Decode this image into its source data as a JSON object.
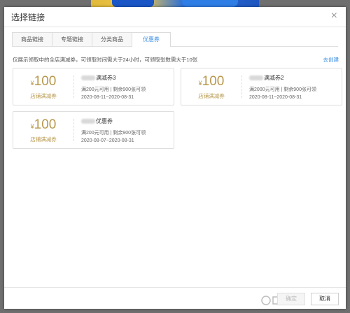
{
  "dialog": {
    "title": "选择链接"
  },
  "tabs": [
    {
      "label": "商品链接",
      "active": false
    },
    {
      "label": "专题链接",
      "active": false
    },
    {
      "label": "分类商品",
      "active": false
    },
    {
      "label": "优惠券",
      "active": true
    }
  ],
  "info": {
    "text": "仅展示领取中的全店满减券，可领取时间需大于24小时，可领取张数需大于10张",
    "create_link": "去创建"
  },
  "coupons": [
    {
      "amount_symbol": "¥",
      "amount": "100",
      "type": "店铺满减券",
      "name": "满减券3",
      "condition": "满200元可用 | 剩余900张可领",
      "dates": "2020-08-11~2020-08-31"
    },
    {
      "amount_symbol": "¥",
      "amount": "100",
      "type": "店铺满减券",
      "name": "满减券2",
      "condition": "满2000元可用 | 剩余900张可领",
      "dates": "2020-08-11~2020-08-31"
    },
    {
      "amount_symbol": "¥",
      "amount": "100",
      "type": "店铺满减券",
      "name": "优惠券",
      "condition": "满200元可用 | 剩余900张可领",
      "dates": "2020-08-07~2020-08-31"
    }
  ],
  "footer": {
    "confirm_label": "确定",
    "cancel_label": "取消"
  },
  "colors": {
    "accent": "#3a8ee6",
    "coupon_gold": "#b8984c"
  }
}
